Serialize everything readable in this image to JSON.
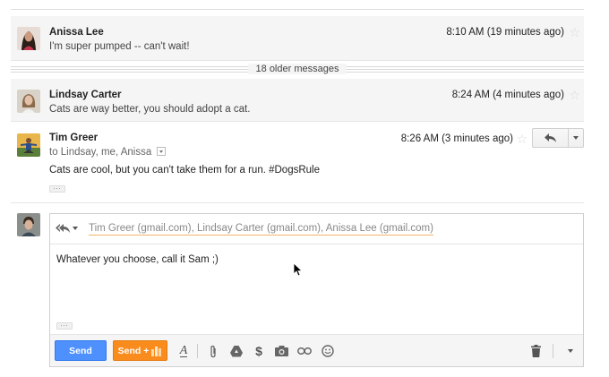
{
  "messages": [
    {
      "sender": "Anissa Lee",
      "snippet": "I'm super pumped -- can't wait!",
      "time": "8:10 AM (19 minutes ago)"
    },
    {
      "sender": "Lindsay Carter",
      "snippet": "Cats are way better, you should adopt a cat.",
      "time": "8:24 AM (4 minutes ago)"
    },
    {
      "sender": "Tim Greer",
      "to": "to Lindsay, me, Anissa",
      "body": "Cats are cool, but you can't take them for a run. #DogsRule",
      "time": "8:26 AM (3 minutes ago)"
    }
  ],
  "older_messages_label": "18 older messages",
  "composer": {
    "recipients": "Tim Greer (gmail.com), Lindsay Carter (gmail.com), Anissa Lee (gmail.com)",
    "body": "Whatever you choose, call it Sam ;)",
    "send_label": "Send",
    "send_plus_label": "Send +"
  },
  "icons": {
    "star": "star-outline-icon",
    "reply": "reply-arrow-icon",
    "reply_all": "reply-all-icon",
    "text_format": "text-format-icon",
    "attach": "paperclip-icon",
    "drive": "google-drive-icon",
    "money": "dollar-icon",
    "photo": "camera-icon",
    "link": "link-icon",
    "emoji": "smiley-icon",
    "trash": "trash-icon"
  },
  "colors": {
    "send_button": "#4d90fe",
    "send_plus_button": "#f98c1c",
    "collapsed_message_bg": "#f5f5f5",
    "recipient_underline": "#f2b56a"
  }
}
